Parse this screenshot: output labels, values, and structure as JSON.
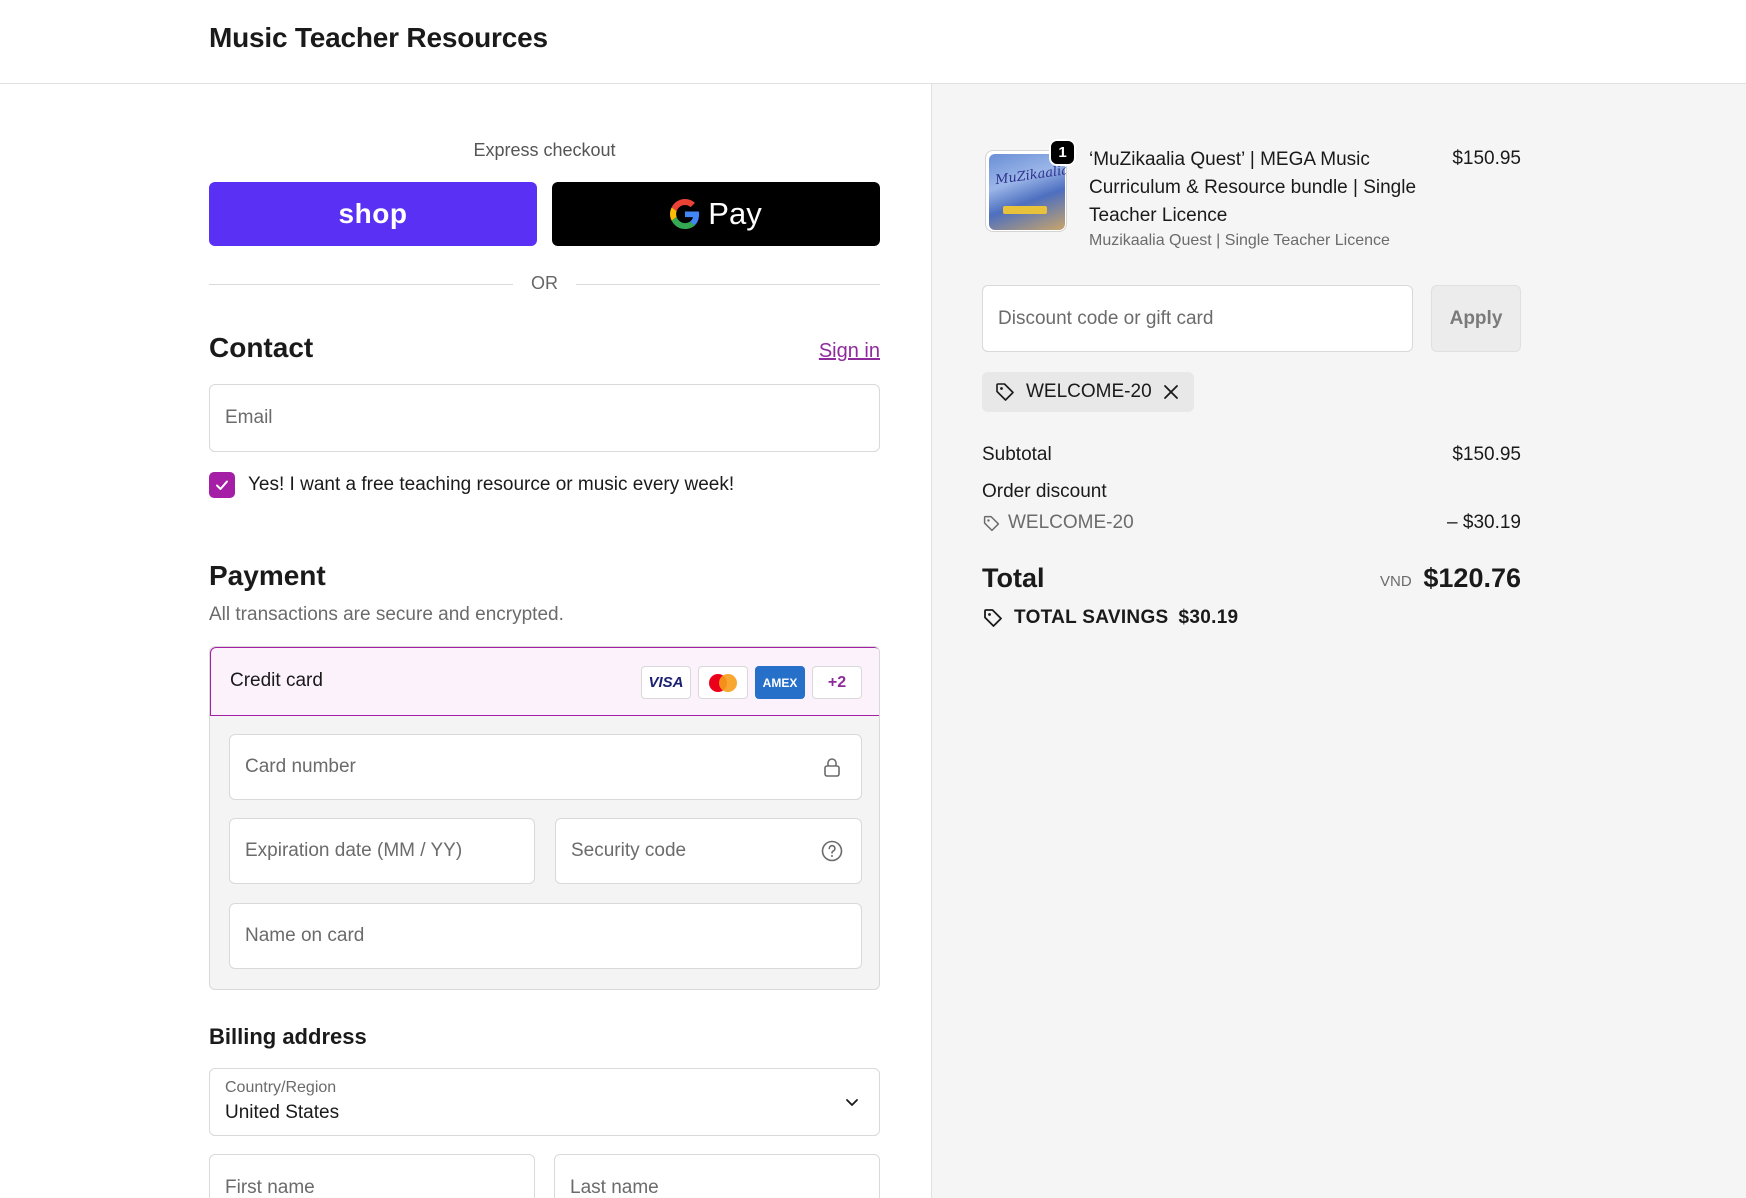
{
  "header": {
    "store_title": "Music Teacher Resources"
  },
  "express": {
    "label": "Express checkout",
    "shop_label": "shop",
    "gpay_label": "Pay",
    "or_label": "OR"
  },
  "contact": {
    "heading": "Contact",
    "sign_in": "Sign in",
    "email_placeholder": "Email",
    "newsletter_label": "Yes! I want a free teaching resource or music every week!",
    "newsletter_checked": true
  },
  "payment": {
    "heading": "Payment",
    "subtitle": "All transactions are secure and encrypted.",
    "method_label": "Credit card",
    "card_brands": [
      "VISA",
      "mastercard",
      "AMEX",
      "+2"
    ],
    "card_number_placeholder": "Card number",
    "expiry_placeholder": "Expiration date (MM / YY)",
    "cvc_placeholder": "Security code",
    "name_placeholder": "Name on card"
  },
  "billing": {
    "heading": "Billing address",
    "country_label": "Country/Region",
    "country_value": "United States",
    "first_name_placeholder": "First name",
    "last_name_placeholder": "Last name"
  },
  "summary": {
    "item": {
      "quantity": "1",
      "name": "‘MuZikaalia Quest’ | MEGA Music Curriculum & Resource bundle | Single Teacher Licence",
      "variant": "Muzikaalia Quest | Single Teacher Licence",
      "price": "$150.95",
      "thumb_text": "MuZikaalia"
    },
    "discount_placeholder": "Discount code or gift card",
    "apply_label": "Apply",
    "applied_code": "WELCOME-20",
    "subtotal_label": "Subtotal",
    "subtotal_value": "$150.95",
    "order_discount_label": "Order discount",
    "discount_code": "WELCOME-20",
    "discount_value": "– $30.19",
    "total_label": "Total",
    "currency": "VND",
    "total_value": "$120.76",
    "savings_label": "TOTAL SAVINGS",
    "savings_value": "$30.19"
  },
  "colors": {
    "accent": "#a41ea6",
    "shop_pay": "#5a31f4",
    "gpay": "#000000",
    "link": "#8e2a9c"
  }
}
